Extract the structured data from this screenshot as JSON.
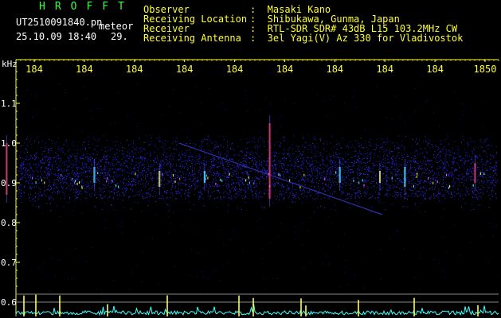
{
  "header": {
    "app_name": "HROFFT",
    "filename": "UT2510091840.pn",
    "mode": "meteor",
    "datetime": "25.10.09 18:40",
    "count": "29.",
    "fields": [
      {
        "label": "Observer",
        "value": ":  Masaki Kano"
      },
      {
        "label": "Receiving Location",
        "value": ":  Shibukawa, Gunma, Japan"
      },
      {
        "label": "Receiver",
        "value": ":  RTL-SDR SDR# 43dB L15 103.2MHz CW"
      },
      {
        "label": "Receiving Antenna",
        "value": ":  3el Yagi(V) Az 330 for Vladivostok"
      }
    ]
  },
  "spectrogram": {
    "y_unit": "kHz",
    "time_labels": [
      "184",
      "184",
      "184",
      "184",
      "184",
      "184",
      "184",
      "184",
      "184",
      "1850"
    ],
    "freq_ticks": [
      {
        "label": "1.1",
        "value": 1.1
      },
      {
        "label": "1.0",
        "value": 1.0
      },
      {
        "label": "0.9",
        "value": 0.9
      },
      {
        "label": "0.8",
        "value": 0.8
      },
      {
        "label": "0.7",
        "value": 0.7
      },
      {
        "label": "0.6",
        "value": 0.6
      }
    ],
    "ylim": [
      0.58,
      1.2
    ],
    "signal_band_khz": [
      0.86,
      0.97
    ],
    "meteor_pings_minutes": [
      1.2,
      2.5,
      3.4,
      4.7,
      6.1,
      6.9,
      7.4,
      8.8
    ],
    "colors": {
      "axis": "#ffff33",
      "grid": "#888888",
      "label": "#ffffff",
      "noise": "#1c1cd0",
      "ping_hot": "#ff3030",
      "ping_warm": "#ffff40",
      "ping_cool": "#40ffff",
      "lower_trace": "#40ffff"
    }
  }
}
